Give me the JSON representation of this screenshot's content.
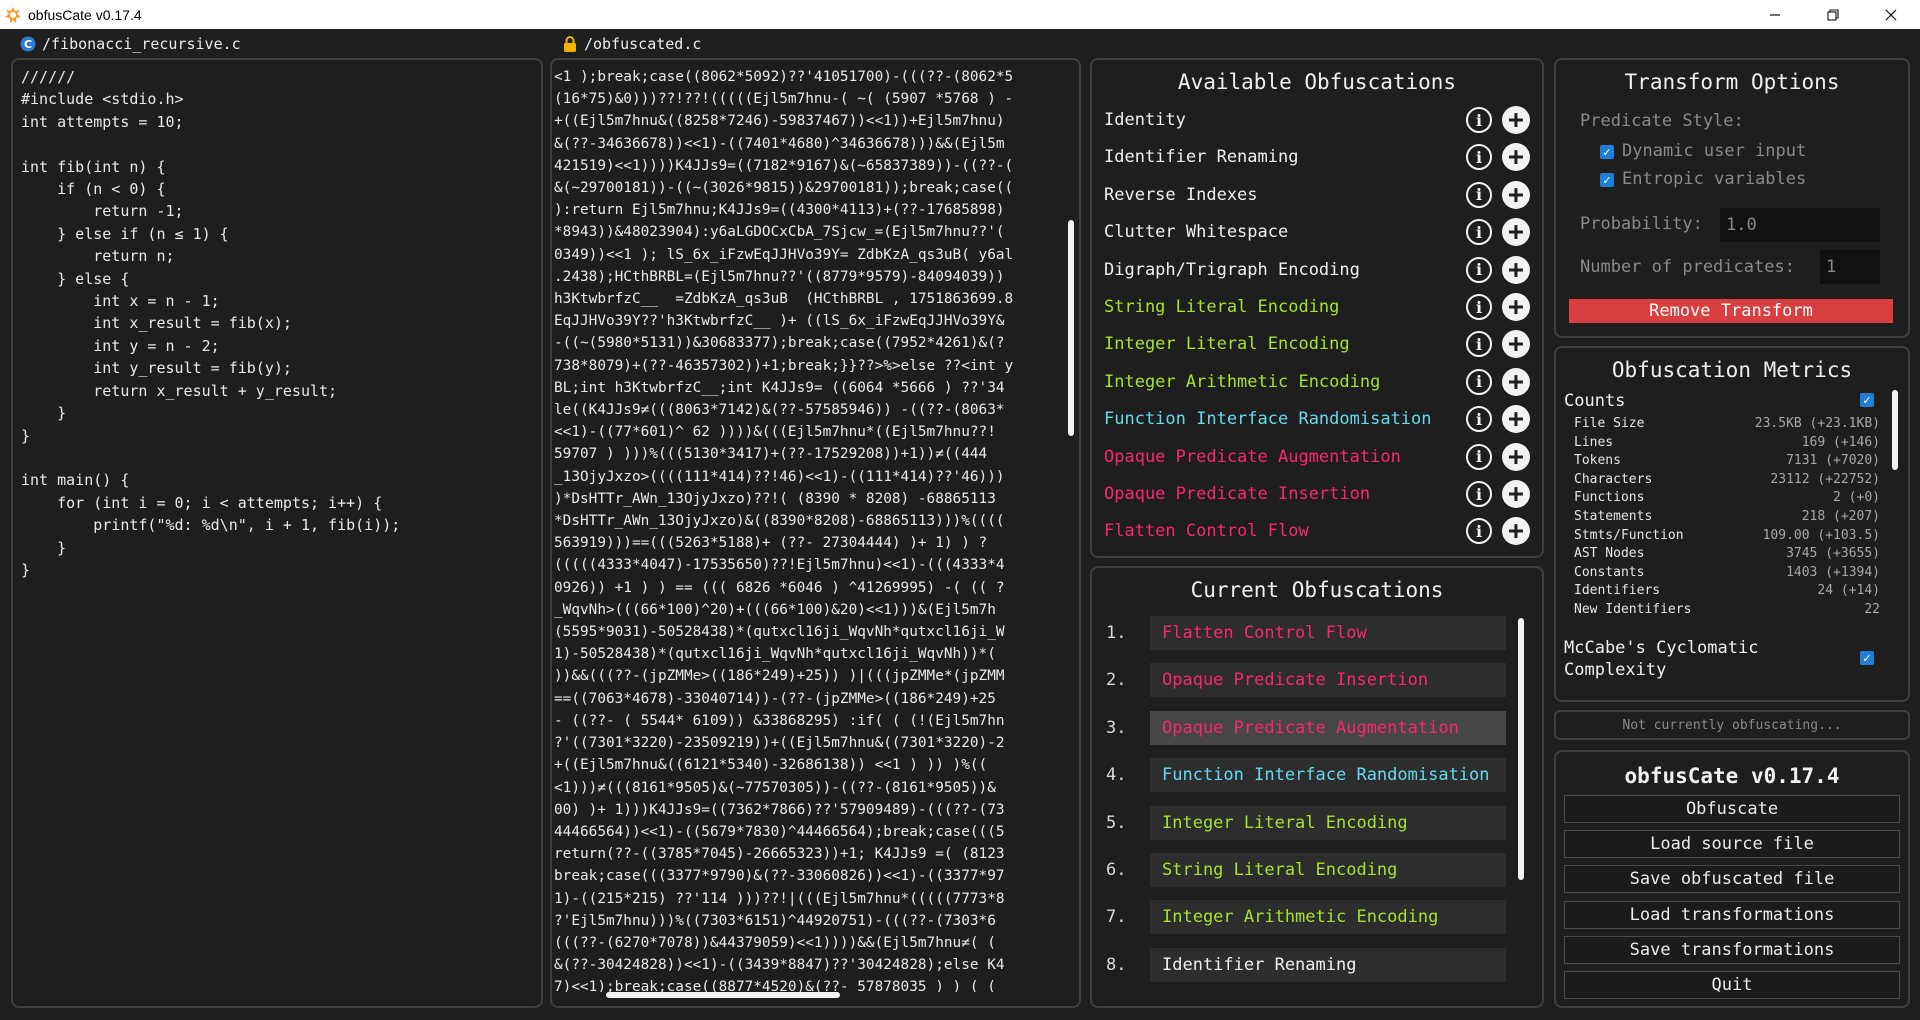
{
  "window": {
    "title": "obfusCate v0.17.4"
  },
  "source": {
    "filename": "/fibonacci_recursive.c",
    "code": "//////\n#include <stdio.h>\nint attempts = 10;\n\nint fib(int n) {\n    if (n < 0) {\n        return -1;\n    } else if (n ≤ 1) {\n        return n;\n    } else {\n        int x = n - 1;\n        int x_result = fib(x);\n        int y = n - 2;\n        int y_result = fib(y);\n        return x_result + y_result;\n    }\n}\n\nint main() {\n    for (int i = 0; i < attempts; i++) {\n        printf(\"%d: %d\\n\", i + 1, fib(i));\n    }\n}"
  },
  "obfuscated": {
    "filename": "/obfuscated.c",
    "code": "<1 );break;case((8062*5092)??'41051700)-(((??-(8062*5\n(16*75)&0)))??!??!(((((Ejl5m7hnu-( ~( (5907 *5768 ) -\n+((Ejl5m7hnu&((8258*7246)-59837467))<<1))+Ejl5m7hnu)\n&(??-34636678))<<1)-((7401*4680)^34636678)))&&(Ejl5m\n421519)<<1))))K4JJs9=((7182*9167)&(~65837389))-((??-(\n&(~29700181))-((~(3026*9815))&29700181));break;case((\n):return Ejl5m7hnu;K4JJs9=((4300*4113)+(??-17685898)\n*8943))&48023904):y6aLGDOCxCbA_7Sjcw_=(Ejl5m7hnu??'(\n0349))<<1 ); lS_6x_iFzwEqJJHVo39Y= ZdbKzA_qs3uB( y6al\n.2438);HCthBRBL=(Ejl5m7hnu??'((8779*9579)-84094039))\nh3KtwbrfzC__  =ZdbKzA_qs3uB  (HCthBRBL , 1751863699.8\nEqJJHVo39Y??'h3KtwbrfzC__ )+ ((lS_6x_iFzwEqJJHVo39Y&\n-((~(5980*5131))&30683377);break;case((7952*4261)&(?\n738*8079)+(??-46357302))+1;break;}}??>%>else ??<int y\nBL;int h3KtwbrfzC__;int K4JJs9= ((6064 *5666 ) ??'34\nle((K4JJs9≠(((8063*7142)&(??-57585946)) -((??-(8063*\n<<1)-((77*601)^ 62 ))))&(((Ejl5m7hnu*((Ejl5m7hnu??!\n59707 ) )))%(((5130*3417)+(??-17529208))+1))≠((444\n_13OjyJxzo>((((111*414)??!46)<<1)-((111*414)??'46)))\n)*DsHTTr_AWn_13OjyJxzo)??!( (8390 * 8208) -68865113 \n*DsHTTr_AWn_13OjyJxzo)&((8390*8208)-68865113)))%((((\n563919)))==(((5263*5188)+ (??- 27304444) )+ 1) ) ?\n(((((4333*4047)-17535650)??!Ejl5m7hnu)<<1)-(((4333*4\n0926)) +1 ) ) == ((( 6826 *6046 ) ^41269995) -( (( ?\n_WqvNh>(((66*100)^20)+(((66*100)&20)<<1)))&(Ejl5m7h\n(5595*9031)-50528438)*(qutxcl16ji_WqvNh*qutxcl16ji_W\n1)-50528438)*(qutxcl16ji_WqvNh*qutxcl16ji_WqvNh))*(\n))&&(((??-(jpZMMe>((186*249)+25)) )|(((jpZMMe*(jpZMM\n==((7063*4678)-33040714))-(??-(jpZMMe>((186*249)+25\n- ((??- ( 5544* 6109)) &33868295) :if( ( (!(Ejl5m7hn\n?'((7301*3220)-23509219))+((Ejl5m7hnu&((7301*3220)-2\n+((Ejl5m7hnu&((6121*5340)-32686138)) <<1 ) )) )%((\n<1)))≠(((8161*9505)&(~77570305))-((??-(8161*9505))&\n00) )+ 1)))K4JJs9=((7362*7866)??'57909489)-(((??-(73\n44466564))<<1)-((5679*7830)^44466564);break;case(((5\nreturn(??-((3785*7045)-26665323))+1; K4JJs9 =( (8123\nbreak;case(((3377*9790)&(??-33060826))<<1)-((3377*97\n1)-((215*215) ??'114 )))??!|(((Ejl5m7hnu*(((((7773*8\n?'Ejl5m7hnu)))%((7303*6151)^44920751)-(((??-(7303*6\n(((??-(6270*7078))&44379059)<<1))))&&(Ejl5m7hnu≠( (\n&(??-30424828))<<1)-((3439*8847)??'30424828);else K4\n7)<<1);break;case((8877*4520)&(??- 57878035 ) ) ( ("
  },
  "available": {
    "title": "Available Obfuscations",
    "items": [
      {
        "label": "Identity",
        "color": "#f0f0f0"
      },
      {
        "label": "Identifier Renaming",
        "color": "#f0f0f0"
      },
      {
        "label": "Reverse Indexes",
        "color": "#f0f0f0"
      },
      {
        "label": "Clutter Whitespace",
        "color": "#f0f0f0"
      },
      {
        "label": "Digraph/Trigraph Encoding",
        "color": "#f0f0f0"
      },
      {
        "label": "String Literal Encoding",
        "color": "#a6e22e"
      },
      {
        "label": "Integer Literal Encoding",
        "color": "#a6e22e"
      },
      {
        "label": "Integer Arithmetic Encoding",
        "color": "#a6e22e"
      },
      {
        "label": "Function Interface Randomisation",
        "color": "#66d9ef"
      },
      {
        "label": "Opaque Predicate Augmentation",
        "color": "#f92672"
      },
      {
        "label": "Opaque Predicate Insertion",
        "color": "#f92672"
      },
      {
        "label": "Flatten Control Flow",
        "color": "#f92672"
      }
    ]
  },
  "current": {
    "title": "Current Obfuscations",
    "items": [
      {
        "num": "1.",
        "label": "Flatten Control Flow",
        "color": "#f92672"
      },
      {
        "num": "2.",
        "label": "Opaque Predicate Insertion",
        "color": "#f92672"
      },
      {
        "num": "3.",
        "label": "Opaque Predicate Augmentation",
        "color": "#f92672"
      },
      {
        "num": "4.",
        "label": "Function Interface Randomisation",
        "color": "#66d9ef"
      },
      {
        "num": "5.",
        "label": "Integer Literal Encoding",
        "color": "#a6e22e"
      },
      {
        "num": "6.",
        "label": "String Literal Encoding",
        "color": "#a6e22e"
      },
      {
        "num": "7.",
        "label": "Integer Arithmetic Encoding",
        "color": "#a6e22e"
      },
      {
        "num": "8.",
        "label": "Identifier Renaming",
        "color": "#f0f0f0"
      }
    ]
  },
  "transform": {
    "title": "Transform Options",
    "predicate_style": "Predicate Style:",
    "dynamic_input": "Dynamic user input",
    "entropic": "Entropic variables",
    "probability_label": "Probability:",
    "probability_value": "1.0",
    "num_predicates_label": "Number of predicates:",
    "num_predicates_value": "1",
    "remove": "Remove Transform"
  },
  "metrics": {
    "title": "Obfuscation Metrics",
    "counts_label": "Counts",
    "rows": [
      {
        "name": "File Size",
        "value": "23.5KB (+23.1KB)"
      },
      {
        "name": "Lines",
        "value": "169 (+146)"
      },
      {
        "name": "Tokens",
        "value": "7131 (+7020)"
      },
      {
        "name": "Characters",
        "value": "23112 (+22752)"
      },
      {
        "name": "Functions",
        "value": "2 (+0)"
      },
      {
        "name": "Statements",
        "value": "218 (+207)"
      },
      {
        "name": "Stmts/Function",
        "value": "109.00 (+103.5)"
      },
      {
        "name": "AST Nodes",
        "value": "3745 (+3655)"
      },
      {
        "name": "Constants",
        "value": "1403 (+1394)"
      },
      {
        "name": "Identifiers",
        "value": "24 (+14)"
      },
      {
        "name": "New Identifiers",
        "value": "22"
      }
    ],
    "mccabe_line1": "McCabe's Cyclomatic",
    "mccabe_line2": "Complexity"
  },
  "status": "Not currently obfuscating...",
  "actions": {
    "title": "obfusCate v0.17.4",
    "buttons": [
      "Obfuscate",
      "Load source file",
      "Save obfuscated file",
      "Load transformations",
      "Save transformations",
      "Quit"
    ]
  },
  "icons": {
    "app": "obfuscate-logo-icon",
    "c_file": "c-file-icon",
    "lock": "lock-icon",
    "info": "info-icon",
    "add": "plus-icon",
    "check": "checkbox-icon"
  }
}
